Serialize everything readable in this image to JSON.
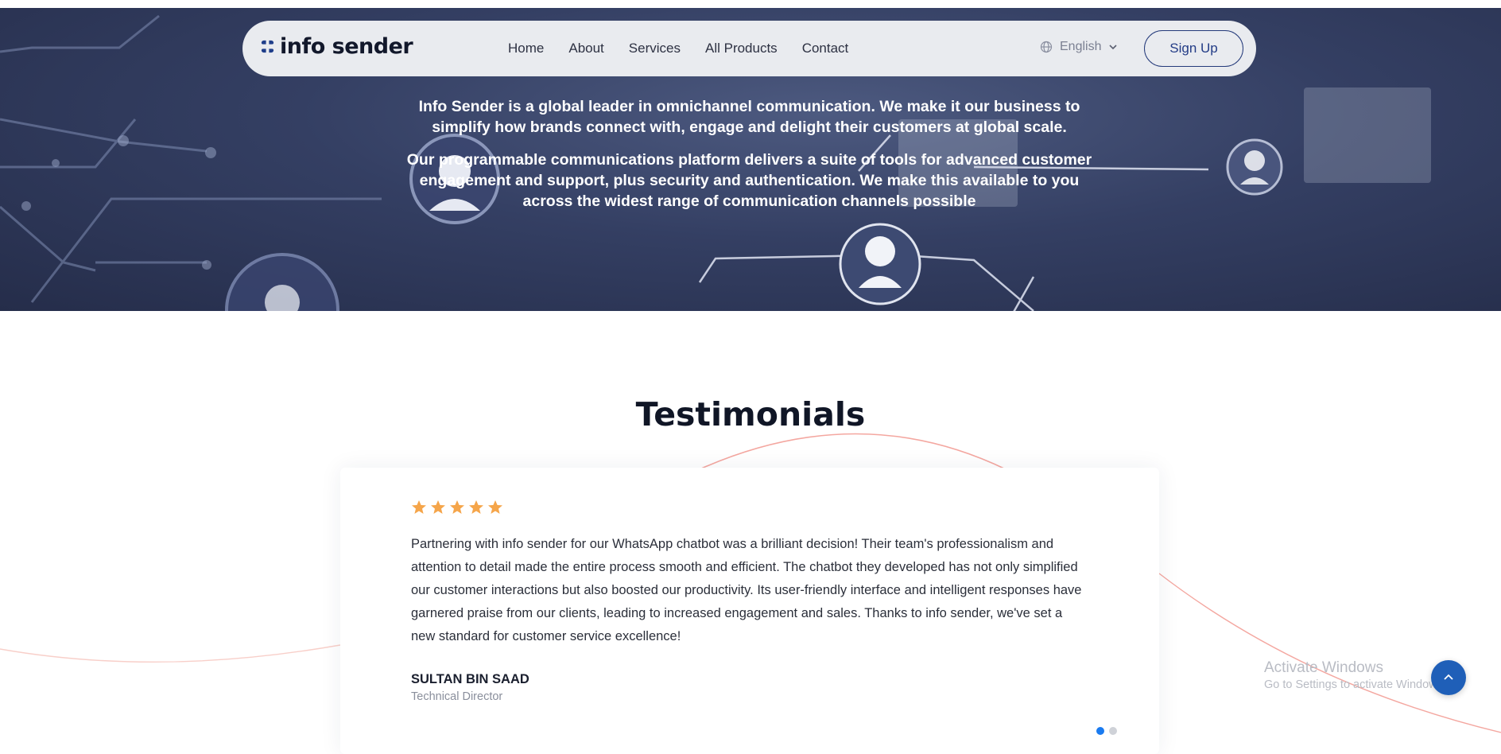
{
  "nav": {
    "logo_text": "info sender",
    "links": [
      "Home",
      "About",
      "Services",
      "All Products",
      "Contact"
    ],
    "language": "English",
    "signup_label": "Sign Up"
  },
  "hero": {
    "paragraph1": "Info Sender is a global leader in omnichannel communication. We make it our business to simplify how brands connect with, engage and delight their customers at global scale.",
    "paragraph2": "Our programmable communications platform delivers a suite of tools for advanced customer engagement and support, plus security and authentication. We make this available to you across the widest range of communication channels possible"
  },
  "testimonials": {
    "title": "Testimonials",
    "rating": 5,
    "quote": "Partnering with info sender for our WhatsApp chatbot was a brilliant decision! Their team's professionalism and attention to detail made the entire process smooth and efficient. The chatbot they developed has not only simplified our customer interactions but also boosted our productivity. Its user-friendly interface and intelligent responses have garnered praise from our clients, leading to increased engagement and sales. Thanks to info sender, we've set a new standard for customer service excellence!",
    "author": "SULTAN BIN SAAD",
    "role": "Technical Director",
    "active_slide": 1,
    "slide_count": 2
  },
  "watermark": {
    "title": "Activate Windows",
    "subtitle": "Go to Settings to activate Windows."
  },
  "colors": {
    "accent": "#1a7bf0",
    "star": "#f5a54a",
    "brand_dark": "#233c86",
    "curve": "#f4a7a0"
  },
  "icons": {
    "logo": "brand-mark-icon",
    "language": "globe-icon",
    "dropdown": "chevron-down-icon",
    "rating": "star-icon",
    "scroll_top": "chevron-up-icon"
  }
}
